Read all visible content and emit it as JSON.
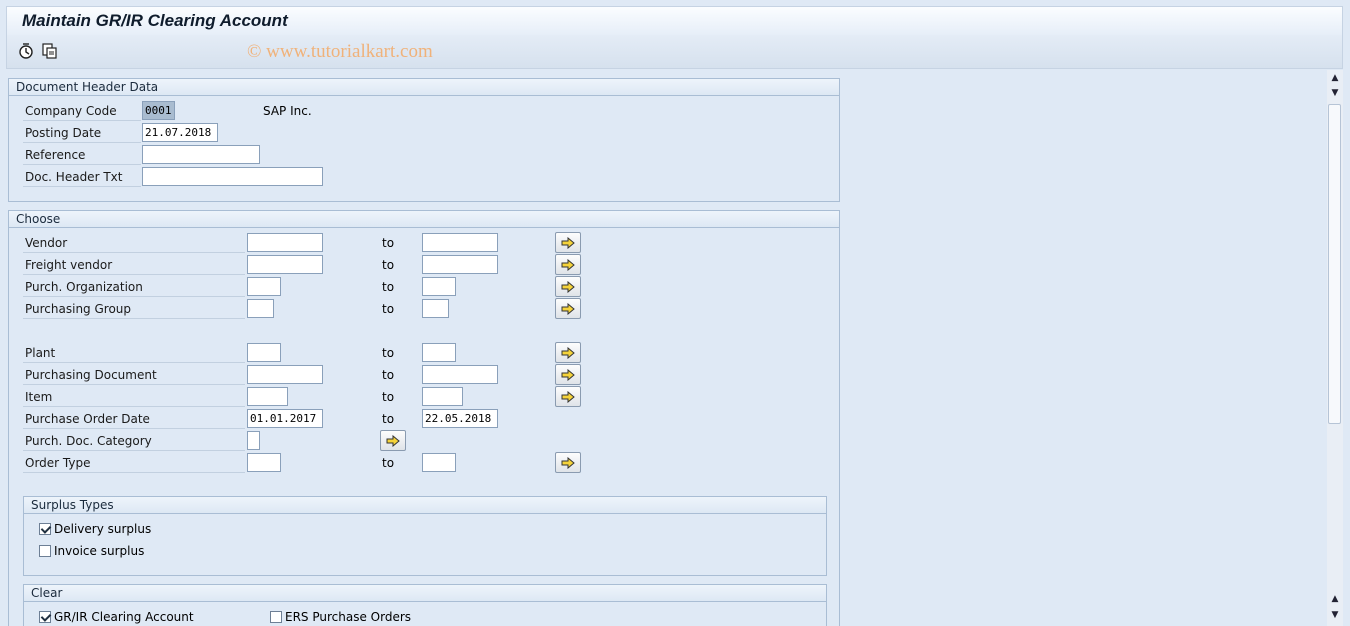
{
  "window": {
    "title": "Maintain GR/IR Clearing Account",
    "watermark": "© www.tutorialkart.com"
  },
  "toolbar": {
    "icons": [
      "execute-icon",
      "get-variant-icon"
    ]
  },
  "header_group": {
    "title": "Document Header Data",
    "company_code_label": "Company Code",
    "company_code_value": "0001",
    "company_name": "SAP Inc.",
    "posting_date_label": "Posting Date",
    "posting_date_value": "21.07.2018",
    "reference_label": "Reference",
    "reference_value": "",
    "doc_header_txt_label": "Doc. Header Txt",
    "doc_header_txt_value": ""
  },
  "choose_group": {
    "title": "Choose",
    "to_label": "to",
    "rows": [
      {
        "label": "Vendor",
        "from": "",
        "to": ""
      },
      {
        "label": "Freight vendor",
        "from": "",
        "to": ""
      },
      {
        "label": "Purch. Organization",
        "from": "",
        "to": ""
      },
      {
        "label": "Purchasing Group",
        "from": "",
        "to": ""
      },
      {
        "label": "Plant",
        "from": "",
        "to": ""
      },
      {
        "label": "Purchasing Document",
        "from": "",
        "to": ""
      },
      {
        "label": "Item",
        "from": "",
        "to": ""
      },
      {
        "label": "Purchase Order Date",
        "from": "01.01.2017",
        "to": "22.05.2018"
      },
      {
        "label": "Purch. Doc. Category",
        "from": ""
      },
      {
        "label": "Order Type",
        "from": "",
        "to": ""
      }
    ]
  },
  "surplus_group": {
    "title": "Surplus Types",
    "delivery_surplus": {
      "label": "Delivery surplus",
      "checked": true
    },
    "invoice_surplus": {
      "label": "Invoice surplus",
      "checked": false
    }
  },
  "clear_group": {
    "title": "Clear",
    "grir_clearing": {
      "label": "GR/IR Clearing Account",
      "checked": true
    },
    "ers_purchase_orders": {
      "label": "ERS Purchase Orders",
      "checked": false
    }
  },
  "colors": {
    "background": "#dfe9f5",
    "group_border": "#a9bdd4",
    "watermark": "#f0b27a",
    "arrow_button_fill": "#f5d33a"
  }
}
